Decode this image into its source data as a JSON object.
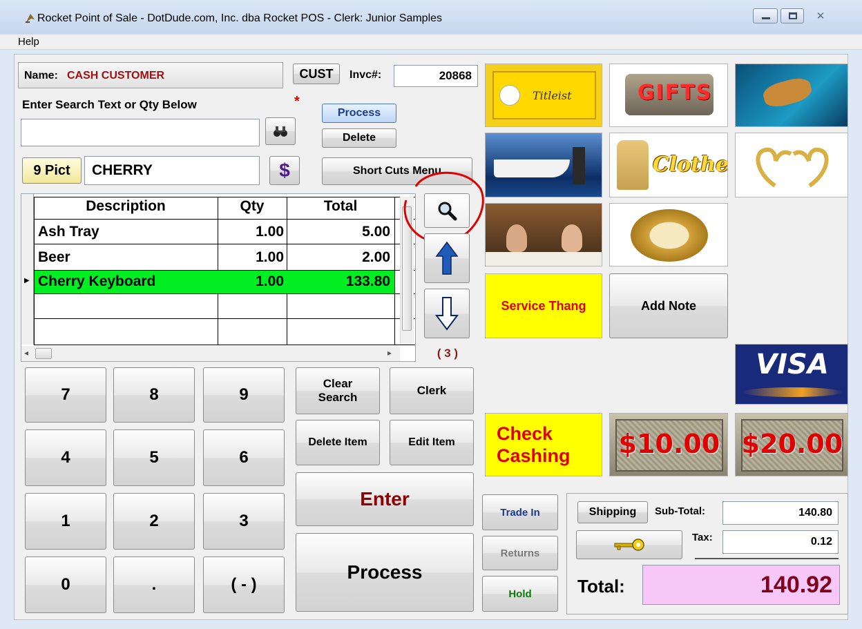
{
  "window": {
    "title": "Rocket Point of Sale - DotDude.com, Inc. dba Rocket POS - Clerk: Junior Samples",
    "menu_help": "Help"
  },
  "customer": {
    "name_label": "Name:",
    "name_value": "CASH CUSTOMER",
    "cust_button": "CUST",
    "invoice_label": "Invc#:",
    "invoice_value": "20868"
  },
  "search": {
    "label": "Enter Search Text or Qty Below",
    "required_marker": "*",
    "value": "",
    "process_button": "Process",
    "delete_button": "Delete",
    "pict_button": "9 Pict",
    "pict_value": "CHERRY",
    "dollar_button": "$",
    "shortcuts_button": "Short Cuts Menu"
  },
  "grid": {
    "headers": [
      "Description",
      "Qty",
      "Total"
    ],
    "rows": [
      {
        "description": "Ash Tray",
        "qty": "1.00",
        "total": "5.00"
      },
      {
        "description": "Beer",
        "qty": "1.00",
        "total": "2.00"
      },
      {
        "description": "Cherry Keyboard",
        "qty": "1.00",
        "total": "133.80"
      }
    ],
    "selected_row": 2,
    "item_count": "( 3 )"
  },
  "keypad": {
    "keys": [
      "7",
      "8",
      "9",
      "4",
      "5",
      "6",
      "1",
      "2",
      "3",
      "0",
      ".",
      "( - )"
    ]
  },
  "actions": {
    "clear_search": "Clear Search",
    "clerk": "Clerk",
    "delete_item": "Delete Item",
    "edit_item": "Edit Item",
    "enter": "Enter",
    "process": "Process",
    "trade_in": "Trade In",
    "returns": "Returns",
    "hold": "Hold"
  },
  "tiles": {
    "titleist_logo": "Titleist",
    "gifts": "GIFTS",
    "clothes": "Clothes",
    "service_thang": "Service Thang",
    "add_note": "Add Note",
    "visa": "VISA",
    "check_cashing": "Check Cashing",
    "bill_10": "$10.00",
    "bill_20": "$20.00"
  },
  "totals": {
    "shipping_button": "Shipping",
    "subtotal_label": "Sub-Total:",
    "subtotal_value": "140.80",
    "tax_label": "Tax:",
    "tax_value": "0.12",
    "total_label": "Total:",
    "total_value": "140.92"
  },
  "colors": {
    "selected_row": "#00ee22",
    "name_value": "#a01010",
    "enter_accent": "#8b0000",
    "service_bg": "#ffff00",
    "service_text": "#e00000",
    "total_bg": "#f7c8f7",
    "total_text": "#800020",
    "annotation_circle": "#e00000"
  }
}
